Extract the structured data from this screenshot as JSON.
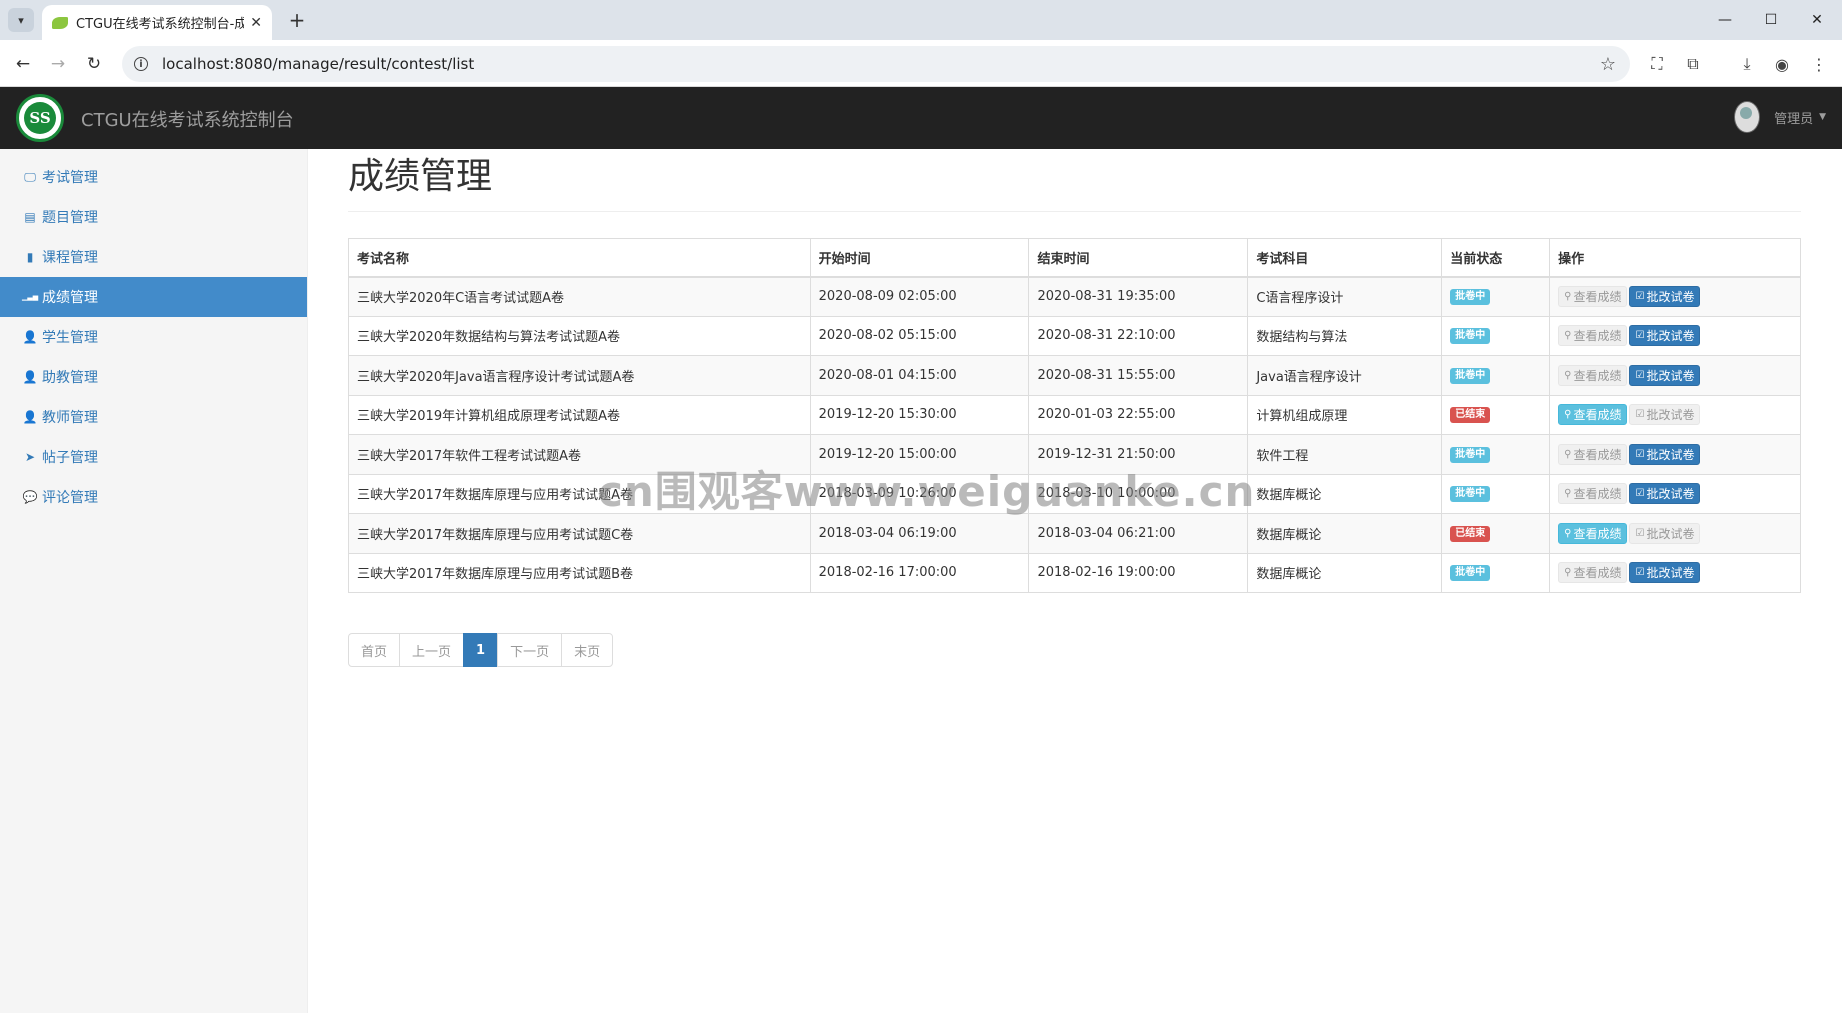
{
  "browser": {
    "tab_title": "CTGU在线考试系统控制台-成绩",
    "url": "localhost:8080/manage/result/contest/list"
  },
  "app": {
    "brand": "CTGU在线考试系统控制台",
    "user_label": "管理员"
  },
  "sidebar": {
    "items": [
      {
        "label": "考试管理",
        "icon": "monitor-icon"
      },
      {
        "label": "题目管理",
        "icon": "list-icon"
      },
      {
        "label": "课程管理",
        "icon": "book-icon"
      },
      {
        "label": "成绩管理",
        "icon": "bar-chart-icon",
        "active": true
      },
      {
        "label": "学生管理",
        "icon": "user-icon"
      },
      {
        "label": "助教管理",
        "icon": "user-icon"
      },
      {
        "label": "教师管理",
        "icon": "user-icon"
      },
      {
        "label": "帖子管理",
        "icon": "send-icon"
      },
      {
        "label": "评论管理",
        "icon": "comment-icon"
      }
    ]
  },
  "main": {
    "title": "成绩管理",
    "table": {
      "headers": [
        "考试名称",
        "开始时间",
        "结束时间",
        "考试科目",
        "当前状态",
        "操作"
      ],
      "rows": [
        {
          "name": "三峡大学2020年C语言考试试题A卷",
          "start": "2020-08-09 02:05:00",
          "end": "2020-08-31 19:35:00",
          "subject": "C语言程序设计",
          "status": "批卷中",
          "status_kind": "info"
        },
        {
          "name": "三峡大学2020年数据结构与算法考试试题A卷",
          "start": "2020-08-02 05:15:00",
          "end": "2020-08-31 22:10:00",
          "subject": "数据结构与算法",
          "status": "批卷中",
          "status_kind": "info"
        },
        {
          "name": "三峡大学2020年Java语言程序设计考试试题A卷",
          "start": "2020-08-01 04:15:00",
          "end": "2020-08-31 15:55:00",
          "subject": "Java语言程序设计",
          "status": "批卷中",
          "status_kind": "info"
        },
        {
          "name": "三峡大学2019年计算机组成原理考试试题A卷",
          "start": "2019-12-20 15:30:00",
          "end": "2020-01-03 22:55:00",
          "subject": "计算机组成原理",
          "status": "已结束",
          "status_kind": "danger"
        },
        {
          "name": "三峡大学2017年软件工程考试试题A卷",
          "start": "2019-12-20 15:00:00",
          "end": "2019-12-31 21:50:00",
          "subject": "软件工程",
          "status": "批卷中",
          "status_kind": "info"
        },
        {
          "name": "三峡大学2017年数据库原理与应用考试试题A卷",
          "start": "2018-03-09 10:26:00",
          "end": "2018-03-10 10:00:00",
          "subject": "数据库概论",
          "status": "批卷中",
          "status_kind": "info"
        },
        {
          "name": "三峡大学2017年数据库原理与应用考试试题C卷",
          "start": "2018-03-04 06:19:00",
          "end": "2018-03-04 06:21:00",
          "subject": "数据库概论",
          "status": "已结束",
          "status_kind": "danger"
        },
        {
          "name": "三峡大学2017年数据库原理与应用考试试题B卷",
          "start": "2018-02-16 17:00:00",
          "end": "2018-02-16 19:00:00",
          "subject": "数据库概论",
          "status": "批卷中",
          "status_kind": "info"
        }
      ],
      "view_label": "查看成绩",
      "grade_label": "批改试卷"
    },
    "pagination": [
      "首页",
      "上一页",
      "1",
      "下一页",
      "末页"
    ]
  },
  "watermark": "cn围观客www.weiguanke.cn"
}
